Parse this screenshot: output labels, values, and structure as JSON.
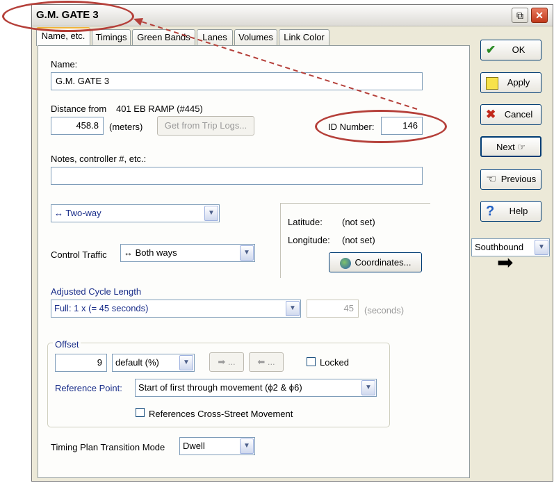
{
  "window": {
    "title": "G.M. GATE 3",
    "restore_icon": "restore-icon",
    "close_icon": "close-icon"
  },
  "tabs": [
    "Name, etc.",
    "Timings",
    "Green Bands",
    "Lanes",
    "Volumes",
    "Link Color"
  ],
  "form": {
    "name_label": "Name:",
    "name_value": "G.M. GATE 3",
    "distance_label": "Distance from",
    "distance_ref": "401 EB RAMP (#445)",
    "distance_value": "458.8",
    "distance_unit": "(meters)",
    "trip_logs_button": "Get from Trip Logs...",
    "id_label": "ID Number:",
    "id_value": "146",
    "notes_label": "Notes, controller #, etc.:",
    "notes_value": "",
    "direction_value": "↔ Two-way",
    "control_traffic_label": "Control Traffic",
    "control_traffic_value": "↔ Both ways",
    "latitude_label": "Latitude:",
    "latitude_value": "(not set)",
    "longitude_label": "Longitude:",
    "longitude_value": "(not set)",
    "coordinates_button": "Coordinates...",
    "cycle_label": "Adjusted Cycle Length",
    "cycle_value": "Full: 1 x (= 45 seconds)",
    "cycle_seconds": "45",
    "cycle_unit": "(seconds)",
    "offset_label": "Offset",
    "offset_value": "9",
    "offset_mode": "default (%)",
    "offset_forward": "➡ ...",
    "offset_back": "⬅ ...",
    "locked_label": "Locked",
    "reference_point_label": "Reference Point:",
    "reference_point_value": "Start of first through movement (ϕ2 & ϕ6)",
    "cross_street_label": "References Cross-Street Movement",
    "transition_label": "Timing Plan Transition Mode",
    "transition_value": "Dwell"
  },
  "side": {
    "ok": "OK",
    "apply": "Apply",
    "cancel": "Cancel",
    "next": "Next",
    "previous": "Previous",
    "help": "Help",
    "direction_value": "Southbound"
  },
  "colors": {
    "accent": "#003c74",
    "annotation": "#b5403a",
    "tab_highlight": "#f1b43a"
  }
}
